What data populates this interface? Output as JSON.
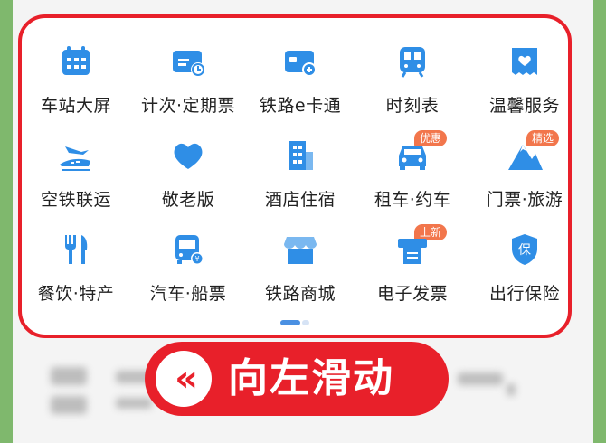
{
  "colors": {
    "accent": "#e8202a",
    "icon_blue": "#2f8ee6",
    "badge": "#f2764c"
  },
  "services": [
    {
      "label": "车站大屏",
      "icon": "calendar-icon"
    },
    {
      "label": "计次·定期票",
      "icon": "ticket-card-icon"
    },
    {
      "label": "铁路e卡通",
      "icon": "rail-card-icon"
    },
    {
      "label": "时刻表",
      "icon": "train-front-icon"
    },
    {
      "label": "温馨服务",
      "icon": "heart-ticket-icon"
    },
    {
      "label": "空铁联运",
      "icon": "plane-train-icon"
    },
    {
      "label": "敬老版",
      "icon": "heart-icon"
    },
    {
      "label": "酒店住宿",
      "icon": "building-icon"
    },
    {
      "label": "租车·约车",
      "icon": "car-icon",
      "badge": "优惠"
    },
    {
      "label": "门票·旅游",
      "icon": "mountain-icon",
      "badge": "精选"
    },
    {
      "label": "餐饮·特产",
      "icon": "fork-knife-icon"
    },
    {
      "label": "汽车·船票",
      "icon": "bus-icon"
    },
    {
      "label": "铁路商城",
      "icon": "store-icon"
    },
    {
      "label": "电子发票",
      "icon": "printer-icon",
      "badge": "上新"
    },
    {
      "label": "出行保险",
      "icon": "shield-icon",
      "shield_text": "保"
    }
  ],
  "swipe": {
    "arrows": "«",
    "text": "向左滑动"
  }
}
